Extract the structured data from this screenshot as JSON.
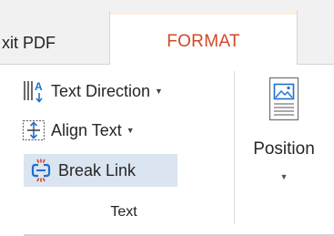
{
  "tabs": {
    "exit_pdf": "xit PDF",
    "format": "FORMAT"
  },
  "commands": {
    "text_direction": "Text Direction",
    "align_text": "Align Text",
    "break_link": "Break Link"
  },
  "group_label": "Text",
  "position": {
    "label": "Position"
  },
  "colors": {
    "accent": "#d24726",
    "hover": "#dbe5f1",
    "icon_blue": "#1f6fd1",
    "icon_orange": "#d24726"
  },
  "icons": {
    "text_direction": "text-direction-icon",
    "align_text": "align-text-icon",
    "break_link": "break-link-icon",
    "position": "position-icon"
  }
}
